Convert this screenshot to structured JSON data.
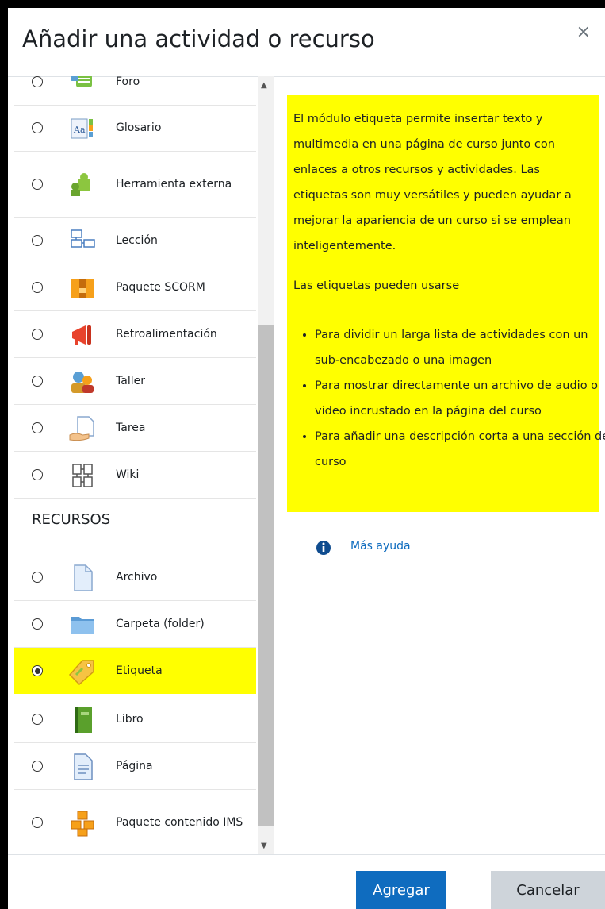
{
  "dialog": {
    "title": "Añadir una actividad o recurso",
    "close_symbol": "×"
  },
  "list": {
    "activities": [
      {
        "label": "Foro",
        "icon": "forum-icon"
      },
      {
        "label": "Glosario",
        "icon": "glossary-icon"
      },
      {
        "label": "Herramienta externa",
        "icon": "puzzle-icon"
      },
      {
        "label": "Lección",
        "icon": "lesson-icon"
      },
      {
        "label": "Paquete SCORM",
        "icon": "scorm-package-icon"
      },
      {
        "label": "Retroalimentación",
        "icon": "megaphone-icon"
      },
      {
        "label": "Taller",
        "icon": "workshop-icon"
      },
      {
        "label": "Tarea",
        "icon": "assignment-icon"
      },
      {
        "label": "Wiki",
        "icon": "wiki-icon"
      }
    ],
    "resources_heading": "RECURSOS",
    "resources": [
      {
        "label": "Archivo",
        "icon": "file-icon"
      },
      {
        "label": "Carpeta (folder)",
        "icon": "folder-icon"
      },
      {
        "label": "Etiqueta",
        "icon": "label-tag-icon",
        "selected": true
      },
      {
        "label": "Libro",
        "icon": "book-icon"
      },
      {
        "label": "Página",
        "icon": "page-icon"
      },
      {
        "label": "Paquete contenido IMS",
        "icon": "ims-package-icon"
      }
    ]
  },
  "help": {
    "paragraph1": "El módulo etiqueta permite insertar texto y multimedia en una página de curso junto con enlaces a otros recursos y actividades. Las etiquetas son muy versátiles y pueden ayudar a mejorar la apariencia de un curso si se emplean inteligentemente.",
    "paragraph2": "Las etiquetas pueden usarse",
    "bullets": [
      "Para dividir un larga lista de actividades con un sub-encabezado o una imagen",
      "Para mostrar directamente un archivo de audio o video incrustado en la página del curso",
      "Para añadir una descripción corta a una sección de curso"
    ],
    "more_help": "Más ayuda",
    "highlight_color": "#ffff00"
  },
  "footer": {
    "add_label": "Agregar",
    "cancel_label": "Cancelar",
    "primary_color": "#0f6cbf"
  }
}
